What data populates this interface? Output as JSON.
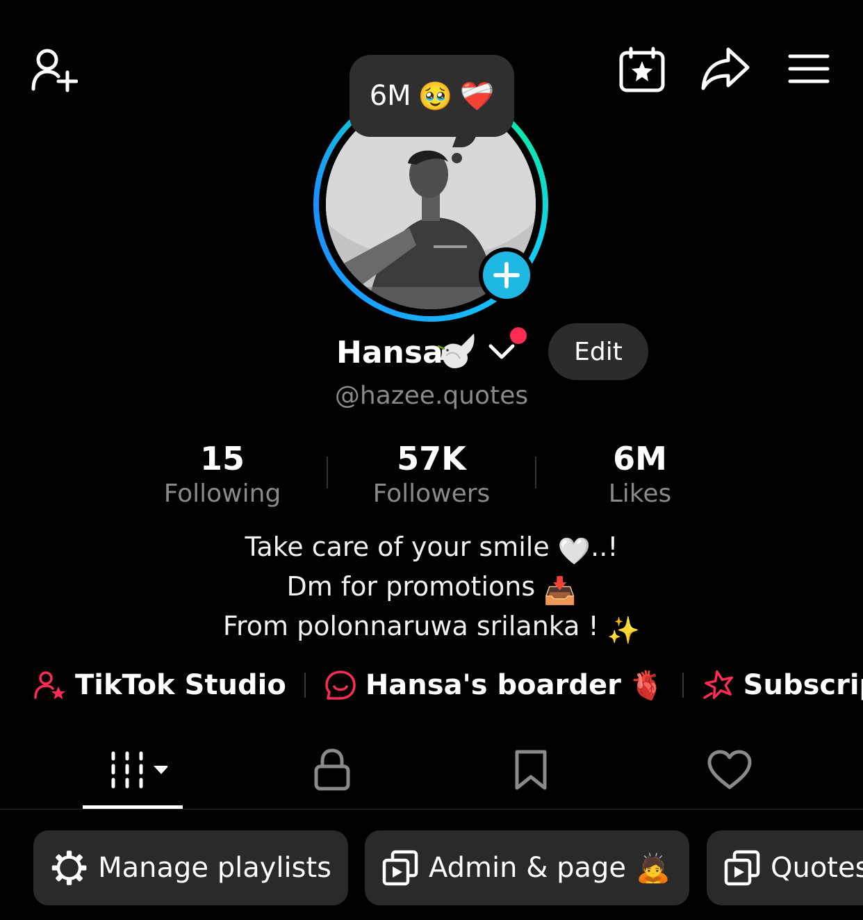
{
  "header": {
    "icons": [
      "add-friend-icon",
      "calendar-star-icon",
      "share-icon",
      "menu-icon"
    ]
  },
  "note": {
    "text": "6M",
    "emoji_1": "🥹",
    "emoji_2": "❤️‍🩹"
  },
  "profile": {
    "name": "Hansa",
    "name_emoji": "🕊️",
    "handle": "@hazee.quotes",
    "edit_label": "Edit"
  },
  "stats": [
    {
      "value": "15",
      "label": "Following"
    },
    {
      "value": "57K",
      "label": "Followers"
    },
    {
      "value": "6M",
      "label": "Likes"
    }
  ],
  "bio": {
    "line1": "Take care of your smile",
    "line1_emoji": "🤍",
    "line1_end": "..!",
    "line2": "Dm for promotions",
    "line2_emoji": "📥",
    "line3": "From polonnaruwa srilanka !",
    "line3_emoji": "✨"
  },
  "links": [
    {
      "label": "TikTok Studio",
      "icon": "creator-star-icon"
    },
    {
      "label": "Hansa's boarder",
      "emoji": "🫀",
      "icon": "chat-smile-icon"
    },
    {
      "label": "Subscription",
      "icon": "star-outline-icon"
    }
  ],
  "tabs": [
    "videos-grid-icon",
    "lock-icon",
    "bookmark-icon",
    "heart-icon"
  ],
  "playlists": [
    {
      "label": "Manage playlists",
      "icon": "gear-icon"
    },
    {
      "label": "Admin & page",
      "emoji": "🙇",
      "icon": "playlist-icon"
    },
    {
      "label": "Quotes",
      "icon": "playlist-icon"
    }
  ],
  "colors": {
    "background": "#000000",
    "accent_red": "#fe2c55",
    "story_blue": "#1fb7e4",
    "ring_teal": "#0ee6b0",
    "muted_text": "#8a8a8a",
    "chip_bg": "#2a2a2a"
  }
}
